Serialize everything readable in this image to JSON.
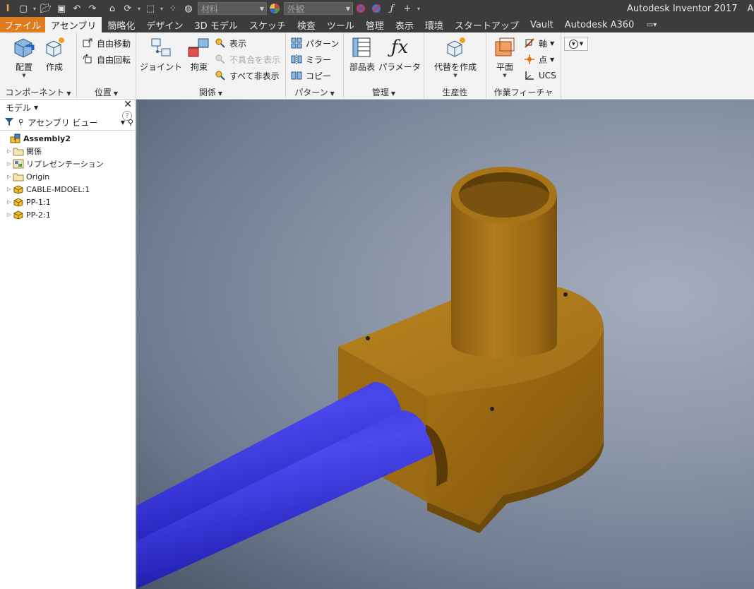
{
  "titlebar": {
    "material_placeholder": "材料",
    "appearance_placeholder": "外観",
    "app_name": "Autodesk Inventor 2017",
    "doc_name": "Ass"
  },
  "tabs": {
    "file": "ファイル",
    "items": [
      "アセンブリ",
      "簡略化",
      "デザイン",
      "3D モデル",
      "スケッチ",
      "検査",
      "ツール",
      "管理",
      "表示",
      "環境",
      "スタートアップ",
      "Vault",
      "Autodesk A360"
    ]
  },
  "ribbon": {
    "component": {
      "title": "コンポーネント",
      "place": "配置",
      "create": "作成"
    },
    "position": {
      "title": "位置",
      "free_move": "自由移動",
      "free_rotate": "自由回転"
    },
    "relationships": {
      "title": "関係",
      "joint": "ジョイント",
      "constrain": "拘束",
      "show": "表示",
      "show_sick": "不具合を表示",
      "hide_all": "すべて非表示"
    },
    "pattern": {
      "title": "パターン",
      "pattern": "パターン",
      "mirror": "ミラー",
      "copy": "コピー"
    },
    "manage": {
      "title": "管理",
      "bom": "部品表",
      "parameters": "パラメータ"
    },
    "productivity": {
      "title": "生産性",
      "substitute": "代替を作成"
    },
    "work_features": {
      "title": "作業フィーチャ",
      "plane": "平面",
      "axis": "軸",
      "point": "点",
      "ucs": "UCS"
    }
  },
  "browser": {
    "title": "モデル",
    "view": "アセンブリ ビュー",
    "help": "?",
    "root": "Assembly2",
    "nodes": [
      "関係",
      "リプレゼンテーション",
      "Origin",
      "CABLE-MDOEL:1",
      "PP-1:1",
      "PP-2:1"
    ]
  },
  "colors": {
    "accent_file_tab": "#e07b1f",
    "part_wood": "#a97417",
    "cable": "#3a37d8"
  }
}
